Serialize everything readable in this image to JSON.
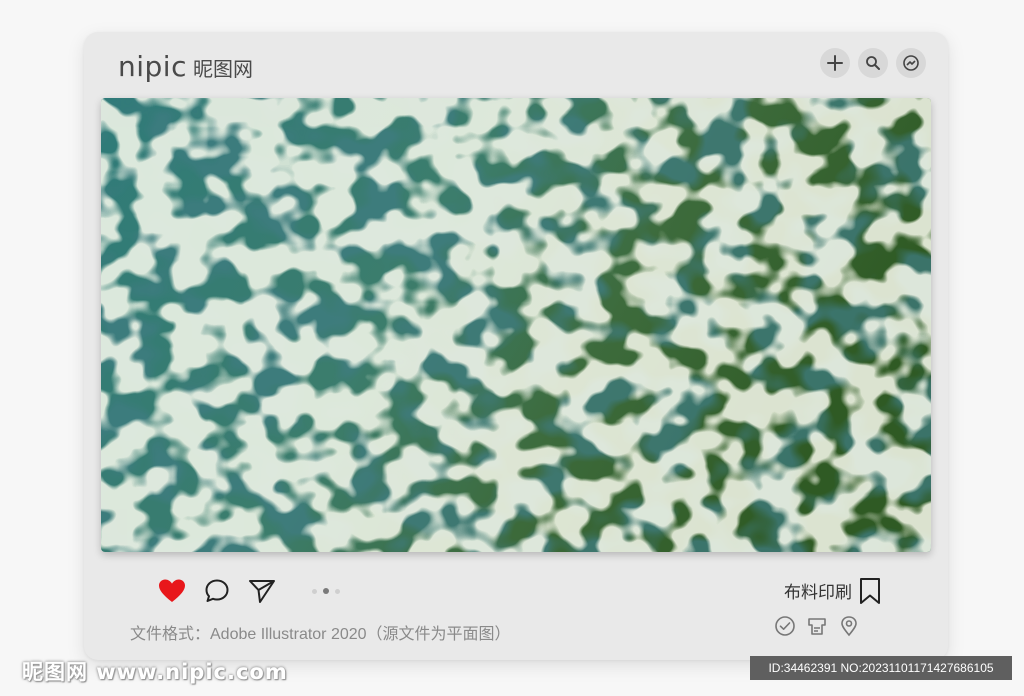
{
  "header": {
    "brand_name": "nipic",
    "brand_cn": "昵图网",
    "icons": [
      "plus-icon",
      "search-icon",
      "messenger-icon"
    ]
  },
  "photo": {
    "subject": "water-ripple-texture"
  },
  "actions": {
    "icons": [
      "heart-icon",
      "comment-icon",
      "send-icon"
    ],
    "like_color": "#e8171b",
    "carousel_active_index": 1,
    "carousel_count": 3
  },
  "category_label": "布料印刷",
  "format_line": "文件格式：Adobe Illustrator 2020（源文件为平面图）",
  "meta_icons": [
    "check-circle-icon",
    "printer-icon",
    "location-pin-icon"
  ],
  "watermark": {
    "site": "昵图网 www.nipic.com",
    "id_line": "ID:34462391 NO:20231101171427686105"
  },
  "colors": {
    "card_bg": "#e9e9e9",
    "page_bg": "#f7f7f7",
    "water_dark": "#1d4e4f",
    "water_teal": "#3f8a86",
    "water_green": "#3e6b2d",
    "highlight": "#f2efcf"
  }
}
